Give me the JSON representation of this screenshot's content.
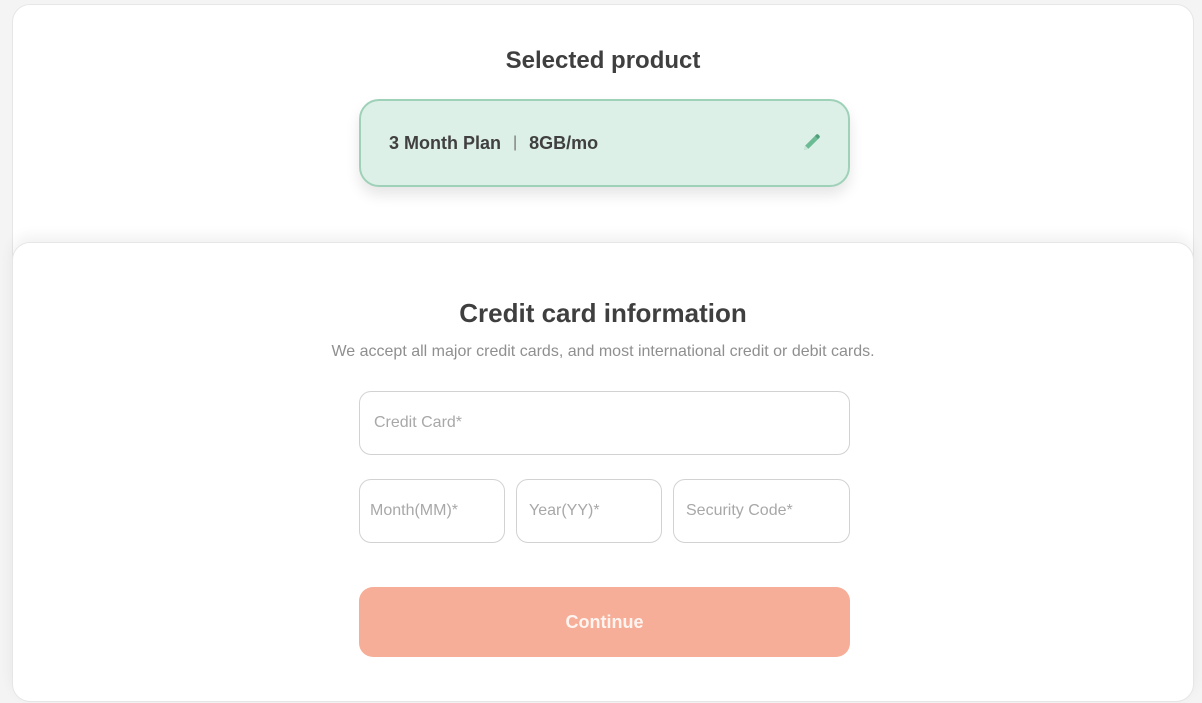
{
  "selected_product": {
    "title": "Selected product",
    "plan": "3 Month Plan",
    "separator": "|",
    "data_allowance": "8GB/mo",
    "edit_icon": "pencil-icon",
    "pill_bg": "#ddf0e7",
    "pill_border": "#9fd1b9",
    "icon_color": "#5fb08a"
  },
  "credit_card": {
    "title": "Credit card information",
    "subtitle": "We accept all major credit cards, and most international credit or debit cards.",
    "card_number": {
      "value": "",
      "placeholder": "Credit Card*"
    },
    "month": {
      "value": "",
      "placeholder": "Month(MM)*"
    },
    "year": {
      "value": "",
      "placeholder": "Year(YY)*"
    },
    "security_code": {
      "value": "",
      "placeholder": "Security Code*"
    },
    "continue_label": "Continue",
    "button_color": "#f6ae98"
  }
}
